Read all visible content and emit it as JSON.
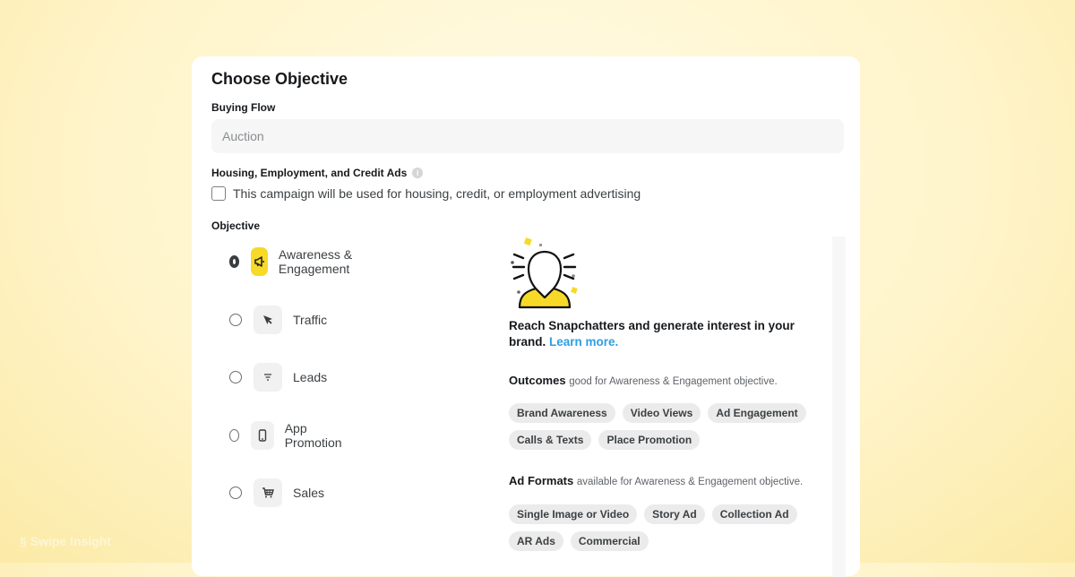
{
  "card": {
    "title": "Choose Objective",
    "buying_flow": {
      "label": "Buying Flow",
      "value": "Auction"
    },
    "special_ads": {
      "label": "Housing, Employment, and Credit Ads",
      "info_icon": "i",
      "checkbox_label": "This campaign will be used for housing, credit, or employment advertising",
      "checked": false
    },
    "objective_label": "Objective",
    "objectives": [
      {
        "label": "Awareness & Engagement",
        "icon": "megaphone-icon",
        "selected": true
      },
      {
        "label": "Traffic",
        "icon": "cursor-icon",
        "selected": false
      },
      {
        "label": "Leads",
        "icon": "filter-icon",
        "selected": false
      },
      {
        "label": "App Promotion",
        "icon": "phone-icon",
        "selected": false
      },
      {
        "label": "Sales",
        "icon": "cart-icon",
        "selected": false
      }
    ],
    "detail": {
      "illustration": "person-spotlight-icon",
      "description": "Reach Snapchatters and generate interest in your brand.",
      "learn_more": "Learn more.",
      "outcomes_title": "Outcomes",
      "outcomes_sub": "good for Awareness & Engagement objective.",
      "outcomes": [
        "Brand Awareness",
        "Video Views",
        "Ad Engagement",
        "Calls & Texts",
        "Place Promotion"
      ],
      "formats_title": "Ad Formats",
      "formats_sub": "available for Awareness & Engagement objective.",
      "formats": [
        "Single Image or Video",
        "Story Ad",
        "Collection Ad",
        "AR Ads",
        "Commercial"
      ]
    }
  },
  "colors": {
    "accent_yellow": "#f7d928",
    "link_blue": "#2e9fe0",
    "chip_bg": "#ebebeb"
  },
  "watermark": "Swipe Insight"
}
